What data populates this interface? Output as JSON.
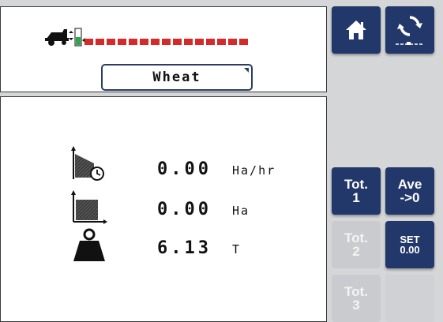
{
  "header": {
    "machine_icon": "combine-harvester-icon",
    "level_indicator_icon": "bin-level-gauge-icon",
    "level_segments": 15,
    "level_color": "#d42a2a",
    "crop_value": "Wheat"
  },
  "metrics": [
    {
      "icon": "area-rate-timer-icon",
      "value": "0.00",
      "unit": "Ha/hr"
    },
    {
      "icon": "area-icon",
      "value": "0.00",
      "unit": "Ha"
    },
    {
      "icon": "weight-icon",
      "value": "6.13",
      "unit": "T"
    }
  ],
  "buttons": {
    "home_icon": "home-icon",
    "cycle_icon": "cycle-icon",
    "tot1": {
      "line1": "Tot.",
      "line2": "1"
    },
    "ave": {
      "line1": "Ave",
      "line2": "->0"
    },
    "tot2": {
      "line1": "Tot.",
      "line2": "2"
    },
    "set": {
      "line1": "SET",
      "line2": "0.00"
    },
    "tot3": {
      "line1": "Tot.",
      "line2": "3"
    }
  },
  "colors": {
    "accent": "#23386a",
    "background": "#d4d6d8",
    "alarm": "#d42a2a"
  }
}
